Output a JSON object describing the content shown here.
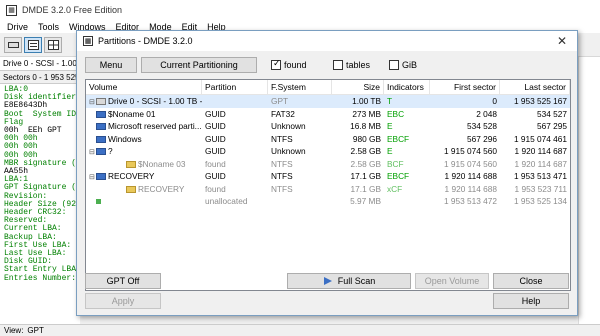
{
  "main": {
    "title": "DMDE 3.2.0 Free Edition",
    "menu": [
      "Drive",
      "Tools",
      "Windows",
      "Editor",
      "Mode",
      "Edit",
      "Help"
    ],
    "drive_select": "Drive 0 - SCSI - 1.00",
    "sectors_line": "Sectors 0 - 1 953 525",
    "code_lines": [
      "LBA:0",
      "Disk identifier",
      "E8E8643Dh",
      "Boot  System ID",
      "Flag",
      "00h  EEh GPT",
      "00h 00h",
      "00h 00h",
      "00h 00h",
      "MBR signature (",
      "AA55h",
      "LBA:1",
      "GPT Signature (",
      "Revision:",
      "Header Size (92",
      "Header CRC32:",
      "Reserved:",
      "Current LBA:",
      "Backup LBA:",
      "First Use LBA:",
      "Last Use LBA:",
      "Disk GUID:",
      "Start Entry LBA",
      "Entries Number:"
    ],
    "status_view": "View:",
    "status_mode": "GPT"
  },
  "dialog": {
    "title": "Partitions - DMDE 3.2.0",
    "close_glyph": "✕",
    "menu_button": "Menu",
    "current_partitioning_button": "Current Partitioning",
    "chk_found": "found",
    "chk_tables": "tables",
    "chk_gib": "GiB",
    "gpt_off_button": "GPT Off",
    "apply_button": "Apply",
    "full_scan_button": "Full Scan",
    "open_volume_button": "Open Volume",
    "close_button": "Close",
    "help_button": "Help",
    "columns": [
      "Volume",
      "Partition",
      "F.System",
      "Size",
      "Indicators",
      "First sector",
      "Last sector"
    ],
    "rows": [
      {
        "volume": "Drive 0 - SCSI - 1.00 TB - T...",
        "partition": "",
        "fs": "GPT",
        "size": "1.00 TB",
        "ind": "T",
        "first": "0",
        "last": "1 953 525 167"
      },
      {
        "volume": "$Noname 01",
        "partition": "GUID",
        "fs": "FAT32",
        "size": "273 MB",
        "ind": "EBC",
        "first": "2 048",
        "last": "534 527"
      },
      {
        "volume": "Microsoft reserved parti...",
        "partition": "GUID",
        "fs": "Unknown",
        "size": "16.8 MB",
        "ind": "E",
        "first": "534 528",
        "last": "567 295"
      },
      {
        "volume": "Windows",
        "partition": "GUID",
        "fs": "NTFS",
        "size": "980 GB",
        "ind": "EBCF",
        "first": "567 296",
        "last": "1 915 074 461"
      },
      {
        "volume": "?",
        "partition": "GUID",
        "fs": "Unknown",
        "size": "2.58 GB",
        "ind": "E",
        "first": "1 915 074 560",
        "last": "1 920 114 687"
      },
      {
        "volume": "$Noname 03",
        "partition": "found",
        "fs": "NTFS",
        "size": "2.58 GB",
        "ind": "BCF",
        "first": "1 915 074 560",
        "last": "1 920 114 687"
      },
      {
        "volume": "RECOVERY",
        "partition": "GUID",
        "fs": "NTFS",
        "size": "17.1 GB",
        "ind": "EBCF",
        "first": "1 920 114 688",
        "last": "1 953 513 471"
      },
      {
        "volume": "RECOVERY",
        "partition": "found",
        "fs": "NTFS",
        "size": "17.1 GB",
        "ind": "xCF",
        "first": "1 920 114 688",
        "last": "1 953 523 711"
      },
      {
        "volume": "",
        "partition": "unallocated",
        "fs": "",
        "size": "5.97 MB",
        "ind": "",
        "first": "1 953 513 472",
        "last": "1 953 525 134"
      }
    ]
  }
}
